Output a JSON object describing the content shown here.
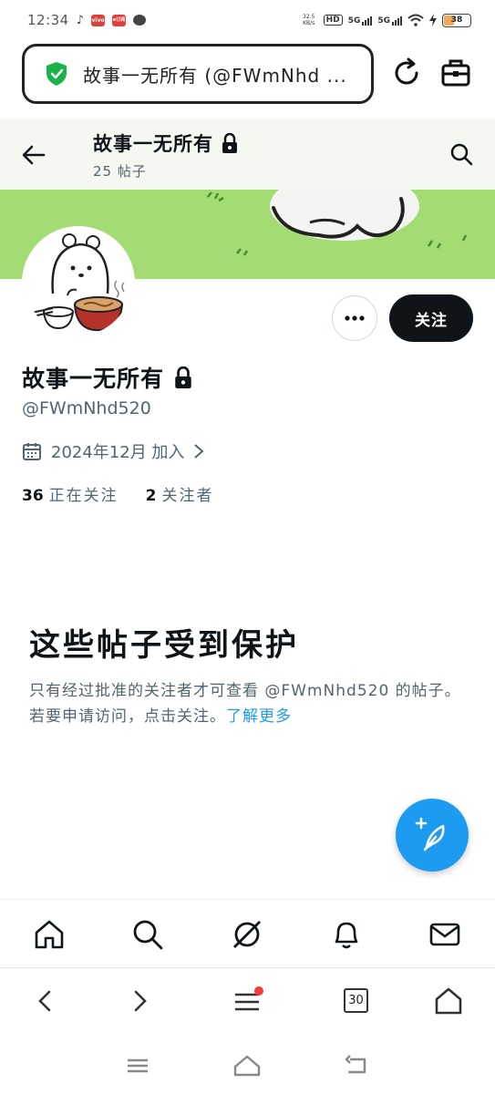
{
  "status_bar": {
    "time": "12:34",
    "app_badges": [
      "vivo",
      "e订阅"
    ],
    "net_speed": "32.5 KB/s",
    "network_labels": [
      "HD",
      "5G",
      "5G"
    ],
    "battery": "38"
  },
  "browser": {
    "url_text": "故事一无所有 (@FWmNhd ...",
    "tab_count": "30"
  },
  "header": {
    "name": "故事一无所有",
    "post_count": "25 帖子"
  },
  "profile": {
    "display_name": "故事一无所有",
    "handle": "@FWmNhd520",
    "joined": "2024年12月 加入",
    "following_count": "36",
    "following_label": "正在关注",
    "followers_count": "2",
    "followers_label": "关注者",
    "follow_button": "关注"
  },
  "protected": {
    "title": "这些帖子受到保护",
    "description": "只有经过批准的关注者才可查看 @FWmNhd520 的帖子。若要申请访问，点击关注。",
    "learn_more": "了解更多"
  },
  "colors": {
    "accent": "#1d9bf0",
    "banner": "#a3dc73",
    "follow_button_bg": "#0f1419",
    "secondary_text": "#536471"
  }
}
